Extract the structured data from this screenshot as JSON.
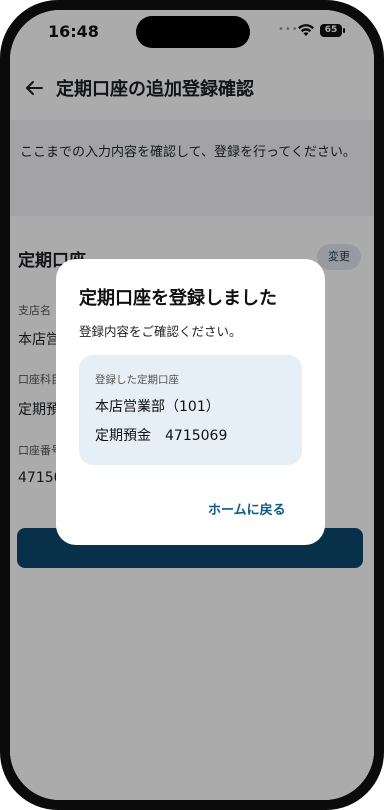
{
  "status_bar": {
    "time": "16:48",
    "battery": "65"
  },
  "header": {
    "title": "定期口座の追加登録確認"
  },
  "lead": {
    "text": "ここまでの入力内容を確認して、登録を行ってください。"
  },
  "card": {
    "title": "定期口座",
    "edit_label": "変更",
    "fields": [
      {
        "label": "支店名",
        "value": "本店営業部（101）"
      },
      {
        "label": "口座科目",
        "value": "定期預金"
      },
      {
        "label": "口座番号",
        "value": "4715069"
      }
    ]
  },
  "modal": {
    "title": "定期口座を登録しました",
    "subtitle": "登録内容をご確認ください。",
    "info_label": "登録した定期口座",
    "branch": "本店営業部（101）",
    "account_type": "定期預金",
    "account_number": "4715069",
    "home_link": "ホームに戻る"
  }
}
